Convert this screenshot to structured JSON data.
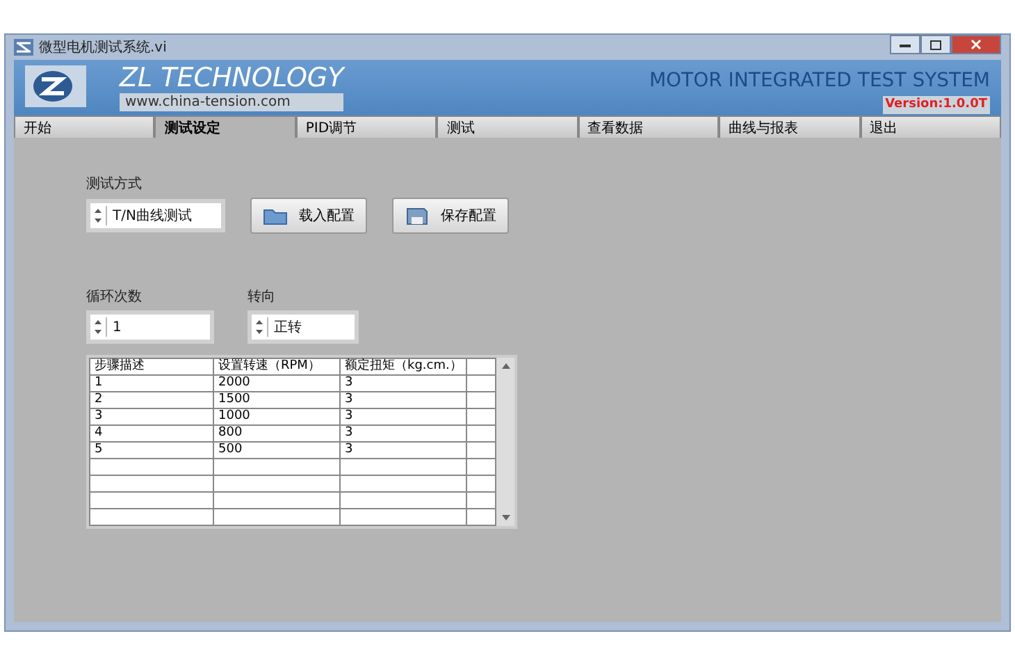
{
  "window": {
    "title": "微型电机测试系统.vi"
  },
  "header": {
    "brand": "ZL TECHNOLOGY",
    "url": "www.china-tension.com",
    "system": "MOTOR INTEGRATED TEST SYSTEM",
    "version": "Version:1.0.0T"
  },
  "tabs": [
    {
      "label": "开始",
      "selected": false
    },
    {
      "label": "测试设定",
      "selected": true
    },
    {
      "label": "PID调节",
      "selected": false
    },
    {
      "label": "测试",
      "selected": false
    },
    {
      "label": "查看数据",
      "selected": false
    },
    {
      "label": "曲线与报表",
      "selected": false
    },
    {
      "label": "退出",
      "selected": false
    }
  ],
  "test_mode": {
    "label": "测试方式",
    "value": "T/N曲线测试"
  },
  "buttons": [
    {
      "kind": "load",
      "label": "载入配置"
    },
    {
      "kind": "save",
      "label": "保存配置"
    }
  ],
  "cycles": {
    "label": "循环次数",
    "value": "1"
  },
  "direction": {
    "label": "转向",
    "value": "正转"
  },
  "table": {
    "columns": [
      "步骤描述",
      "设置转速（RPM）",
      "额定扭矩（kg.cm.）"
    ],
    "rows": [
      [
        "1",
        "2000",
        "3"
      ],
      [
        "2",
        "1500",
        "3"
      ],
      [
        "3",
        "1000",
        "3"
      ],
      [
        "4",
        "800",
        "3"
      ],
      [
        "5",
        "500",
        "3"
      ]
    ]
  }
}
